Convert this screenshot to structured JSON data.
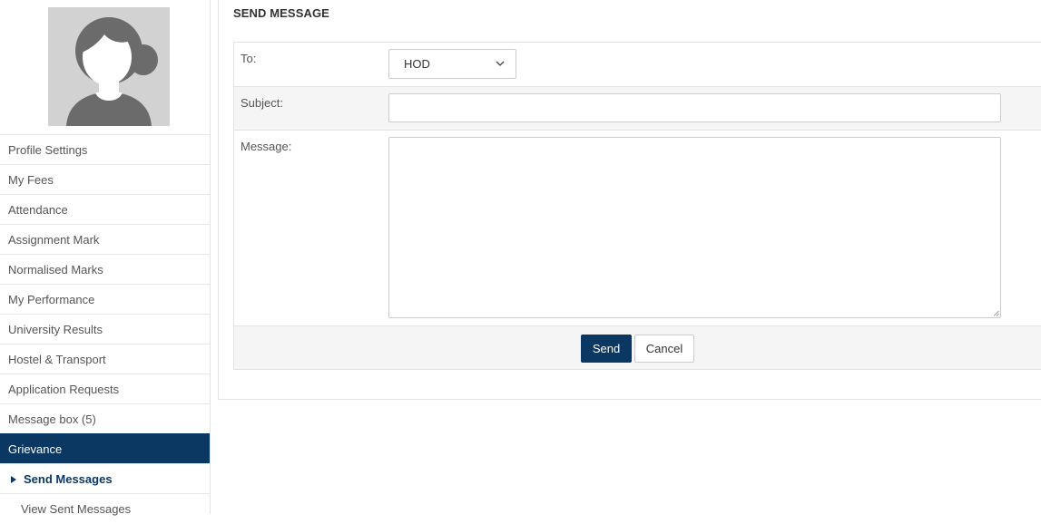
{
  "sidebar": {
    "items": [
      {
        "label": "Profile Settings"
      },
      {
        "label": "My Fees"
      },
      {
        "label": "Attendance"
      },
      {
        "label": "Assignment Mark"
      },
      {
        "label": "Normalised Marks"
      },
      {
        "label": "My Performance"
      },
      {
        "label": "University Results"
      },
      {
        "label": "Hostel & Transport"
      },
      {
        "label": "Application Requests"
      },
      {
        "label": "Message box (5)"
      },
      {
        "label": "Grievance"
      }
    ],
    "active_item": "Grievance",
    "sub_items": [
      {
        "label": "Send Messages"
      },
      {
        "label": "View Sent Messages"
      }
    ],
    "current_sub_item": "Send Messages"
  },
  "panel": {
    "title": "SEND MESSAGE"
  },
  "form": {
    "to_label": "To:",
    "to_value": "HOD",
    "subject_label": "Subject:",
    "subject_value": "",
    "message_label": "Message:",
    "message_value": ""
  },
  "actions": {
    "send_label": "Send",
    "cancel_label": "Cancel"
  },
  "colors": {
    "accent": "#0b3763",
    "row_alt": "#f5f5f5",
    "border": "#e3e3e3"
  }
}
